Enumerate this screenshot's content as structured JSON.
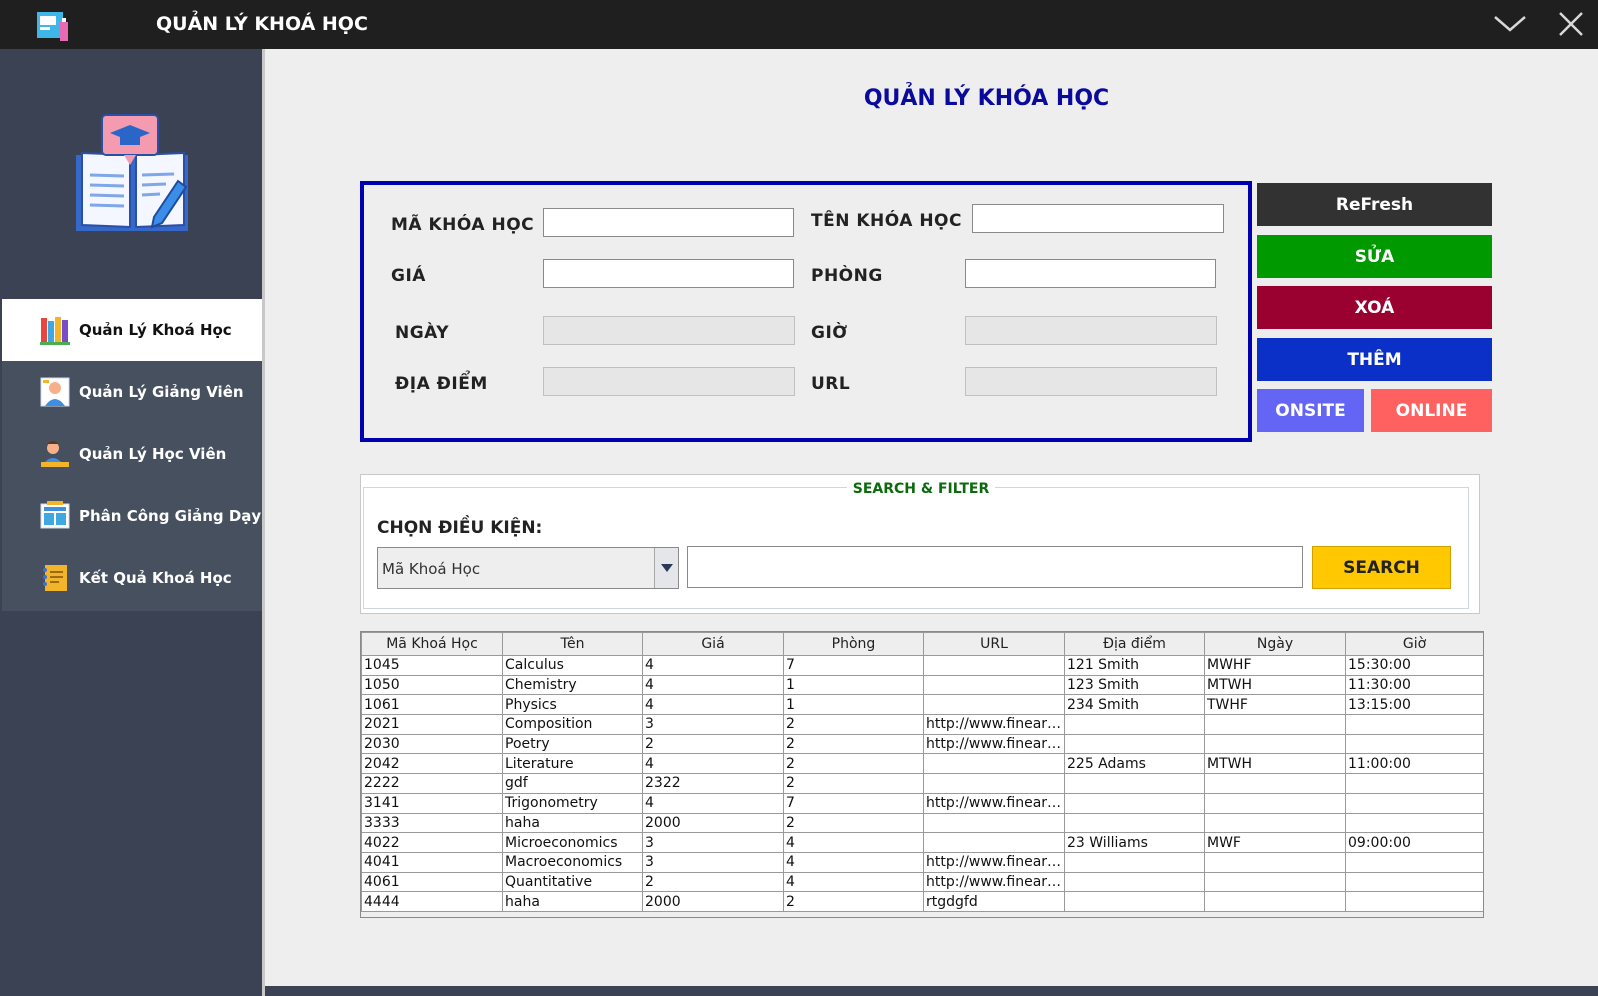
{
  "window": {
    "title": "QUẢN LÝ KHOÁ HỌC"
  },
  "sidebar": {
    "items": [
      {
        "label": "Quản Lý Khoá Học",
        "active": true
      },
      {
        "label": "Quản Lý Giảng Viên",
        "active": false
      },
      {
        "label": "Quản Lý Học Viên",
        "active": false
      },
      {
        "label": "Phân Công Giảng Dạy",
        "active": false
      },
      {
        "label": "Kết Quả Khoá Học",
        "active": false
      }
    ]
  },
  "main": {
    "title": "QUẢN LÝ KHÓA HỌC",
    "form": {
      "ma_label": "MÃ KHÓA HỌC",
      "ma_value": "",
      "ten_label": "TÊN KHÓA HỌC",
      "ten_value": "",
      "gia_label": "GIÁ",
      "gia_value": "",
      "phong_label": "PHÒNG",
      "phong_value": "",
      "ngay_label": "NGÀY",
      "ngay_value": "",
      "gio_label": "GIỜ",
      "gio_value": "",
      "diadiem_label": "ĐỊA ĐIỂM",
      "diadiem_value": "",
      "url_label": "URL",
      "url_value": ""
    },
    "buttons": {
      "refresh": "ReFresh",
      "edit": "SỬA",
      "delete": "XOÁ",
      "add": "THÊM",
      "onsite": "ONSITE",
      "online": "ONLINE"
    },
    "search": {
      "legend": "SEARCH & FILTER",
      "condition_label": "CHỌN ĐIỀU KIỆN:",
      "condition_selected": "Mã Khoá Học",
      "query_value": "",
      "button": "SEARCH"
    },
    "table": {
      "columns": [
        "Mã Khoá Học",
        "Tên",
        "Giá",
        "Phòng",
        "URL",
        "Địa điểm",
        "Ngày",
        "Giờ"
      ],
      "rows": [
        [
          "1045",
          "Calculus",
          "4",
          "7",
          "",
          "121 Smith",
          "MWHF",
          "15:30:00"
        ],
        [
          "1050",
          "Chemistry",
          "4",
          "1",
          "",
          "123 Smith",
          "MTWH",
          "11:30:00"
        ],
        [
          "1061",
          "Physics",
          "4",
          "1",
          "",
          "234 Smith",
          "TWHF",
          "13:15:00"
        ],
        [
          "2021",
          "Composition",
          "3",
          "2",
          "http://www.fineartsc...",
          "",
          "",
          ""
        ],
        [
          "2030",
          "Poetry",
          "2",
          "2",
          "http://www.fineartsc...",
          "",
          "",
          ""
        ],
        [
          "2042",
          "Literature",
          "4",
          "2",
          "",
          "225 Adams",
          "MTWH",
          "11:00:00"
        ],
        [
          "2222",
          "gdf",
          "2322",
          "2",
          "",
          "",
          "",
          ""
        ],
        [
          "3141",
          "Trigonometry",
          "4",
          "7",
          "http://www.fineartsc...",
          "",
          "",
          ""
        ],
        [
          "3333",
          "haha",
          "2000",
          "2",
          "",
          "",
          "",
          ""
        ],
        [
          "4022",
          "Microeconomics",
          "3",
          "4",
          "",
          "23 Williams",
          "MWF",
          "09:00:00"
        ],
        [
          "4041",
          "Macroeconomics",
          "3",
          "4",
          "http://www.fineartsc...",
          "",
          "",
          ""
        ],
        [
          "4061",
          "Quantitative",
          "2",
          "4",
          "http://www.fineartsc...",
          "",
          "",
          ""
        ],
        [
          "4444",
          "haha",
          "2000",
          "2",
          "rtgdgfd",
          "",
          "",
          ""
        ]
      ]
    }
  },
  "colors": {
    "refresh": "#323232",
    "edit": "#009a00",
    "delete": "#9a0030",
    "add": "#0b30c8",
    "onsite": "#6464f5",
    "online": "#ff6060",
    "search": "#ffc800",
    "title": "#0a0a9c"
  }
}
